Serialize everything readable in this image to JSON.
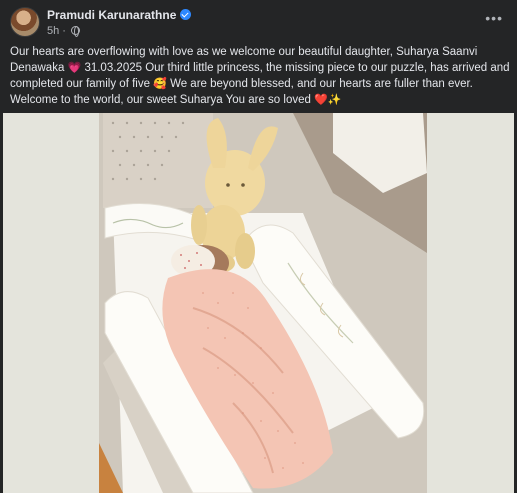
{
  "post": {
    "author": "Pramudi Karunarathne",
    "time": "5h",
    "more_label": "•••",
    "text_part1": "Our hearts are overflowing with love as we welcome our beautiful daughter, Suharya Saanvi Denawaka ",
    "emoji_heart_pink": "💗",
    "text_part2": " 31.03.2025 Our third little princess, the missing piece to our puzzle, has arrived and completed our family of five ",
    "emoji_smile_hearts": "🥰",
    "text_part3": " We are beyond blessed, and our hearts are fuller than ever. Welcome to the world, our sweet Suharya You are so loved ",
    "emoji_heart_red": "❤️",
    "emoji_sparkles": "✨"
  },
  "icons": {
    "verified": "verified-badge-icon",
    "audience": "globe-icon",
    "options": "more-options-icon"
  },
  "colors": {
    "background": "#242526",
    "text_primary": "#e4e6eb",
    "text_secondary": "#b0b3b8",
    "verified_blue": "#2d88ff"
  }
}
